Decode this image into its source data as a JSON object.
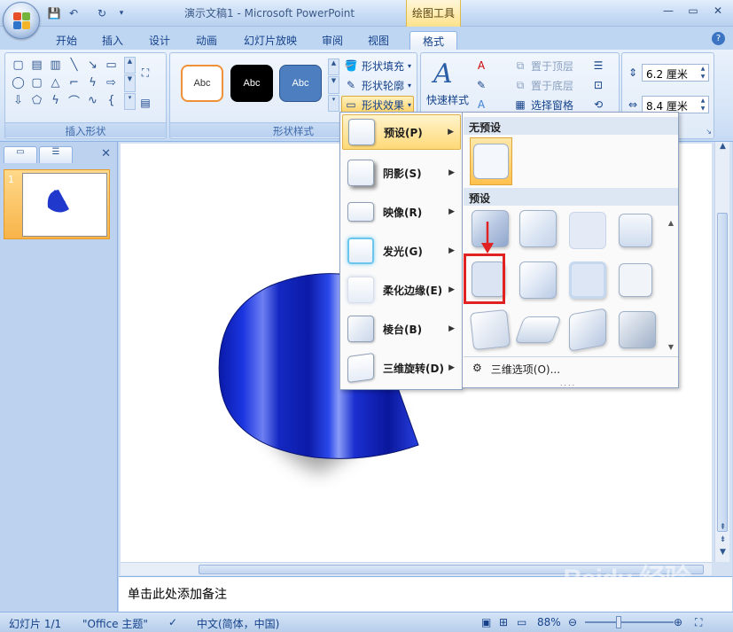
{
  "titlebar": {
    "title": "演示文稿1 - Microsoft PowerPoint",
    "contextual_tab": "绘图工具"
  },
  "tabs": [
    "开始",
    "插入",
    "设计",
    "动画",
    "幻灯片放映",
    "审阅",
    "视图",
    "格式"
  ],
  "active_tab": "格式",
  "ribbon": {
    "insert_shapes_label": "插入形状",
    "shape_styles_label": "形状样式",
    "style_samples": [
      "Abc",
      "Abc",
      "Abc"
    ],
    "shape_fill": "形状填充",
    "shape_outline": "形状轮廓",
    "shape_effects": "形状效果",
    "quick_styles": "快速样式",
    "bring_to_front": "置于顶层",
    "send_to_back": "置于底层",
    "selection_pane": "选择窗格",
    "height_value": "6.2 厘米",
    "width_value": "8.4 厘米"
  },
  "effects_menu": {
    "items": [
      "预设(P)",
      "阴影(S)",
      "映像(R)",
      "发光(G)",
      "柔化边缘(E)",
      "棱台(B)",
      "三维旋转(D)"
    ],
    "hot_item": "预设(P)"
  },
  "preset_panel": {
    "no_preset_header": "无预设",
    "preset_header": "预设",
    "options_label": "三维选项(O)...",
    "grip": "...."
  },
  "slides_panel": {
    "slide_number": "1"
  },
  "notes_placeholder": "单击此处添加备注",
  "statusbar": {
    "slide_info": "幻灯片 1/1",
    "theme": "\"Office 主题\"",
    "language": "中文(简体，中国)",
    "zoom": "88%"
  },
  "watermark": {
    "brand": "Baidu 经验",
    "url": "jingyan.baidu.com"
  },
  "colors": {
    "accent_orange": "#f8b449",
    "ribbon_blue": "#bfd6f2",
    "shape_blue": "#1026c8",
    "highlight_red": "#e02222"
  }
}
